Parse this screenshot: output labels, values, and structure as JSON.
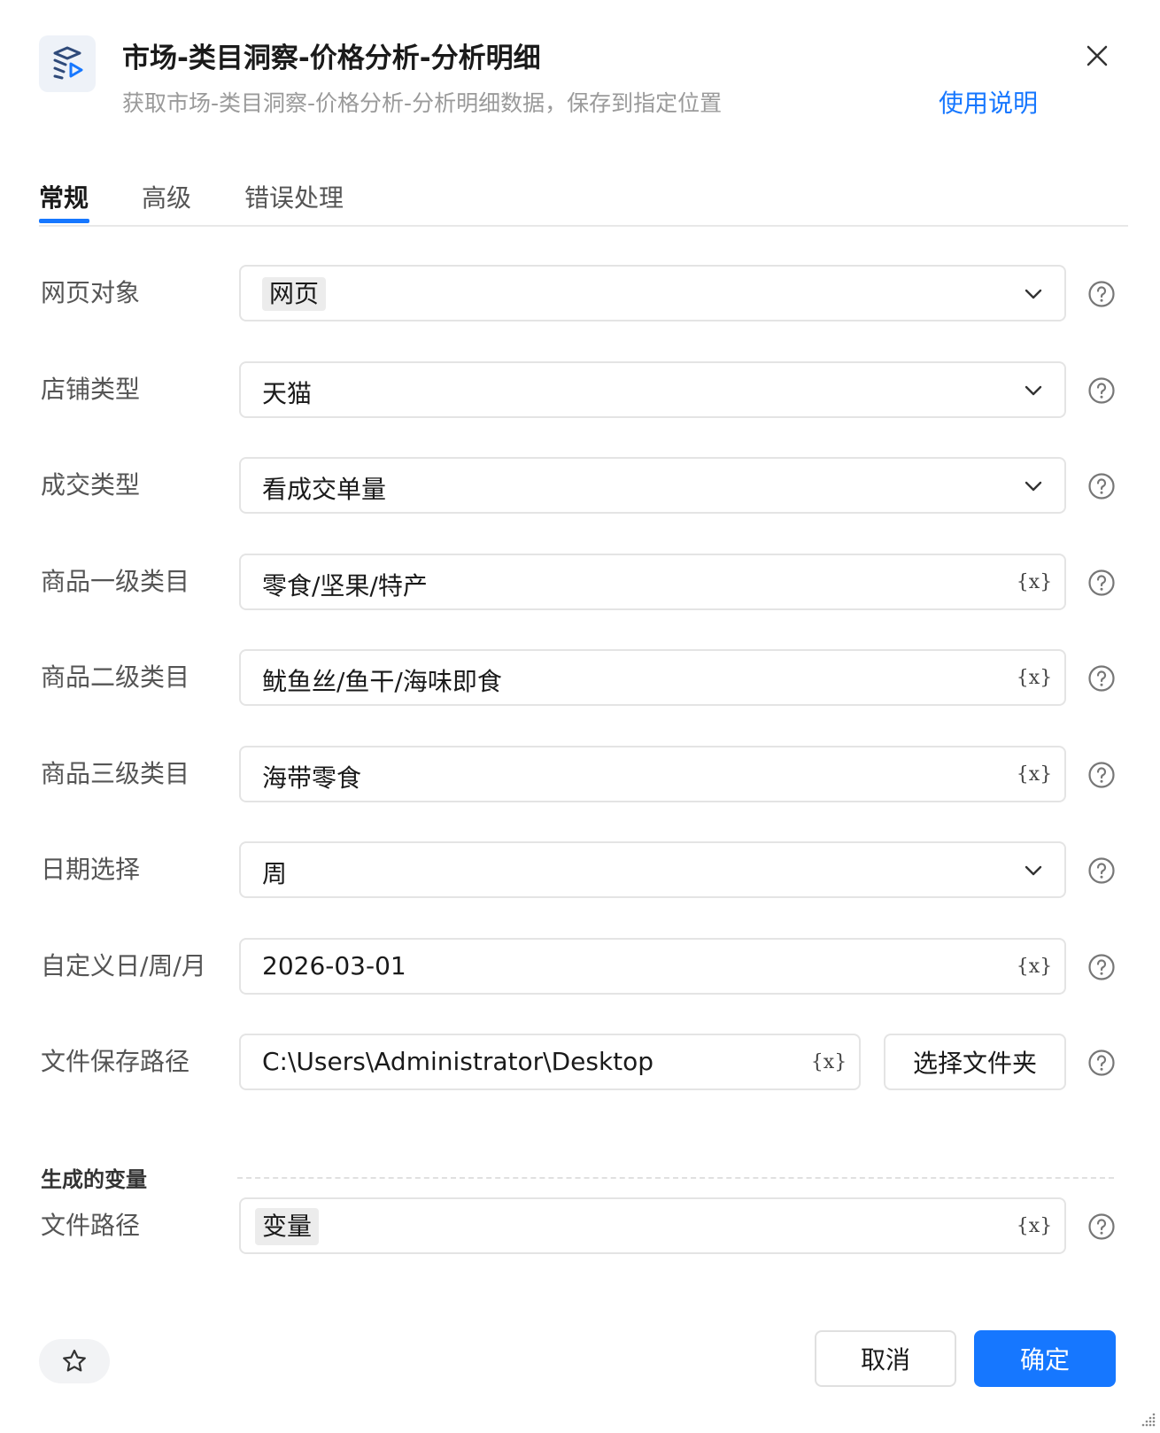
{
  "header": {
    "title": "市场-类目洞察-价格分析-分析明细",
    "subtitle": "获取市场-类目洞察-价格分析-分析明细数据，保存到指定位置",
    "help_link": "使用说明"
  },
  "tabs": [
    {
      "label": "常规",
      "active": true
    },
    {
      "label": "高级",
      "active": false
    },
    {
      "label": "错误处理",
      "active": false
    }
  ],
  "fields": {
    "webpage": {
      "label": "网页对象",
      "value": "网页"
    },
    "store_type": {
      "label": "店铺类型",
      "value": "天猫"
    },
    "deal_type": {
      "label": "成交类型",
      "value": "看成交单量"
    },
    "category_l1": {
      "label": "商品一级类目",
      "value": "零食/坚果/特产"
    },
    "category_l2": {
      "label": "商品二级类目",
      "value": "鱿鱼丝/鱼干/海味即食"
    },
    "category_l3": {
      "label": "商品三级类目",
      "value": "海带零食"
    },
    "date_select": {
      "label": "日期选择",
      "value": "周"
    },
    "custom_date": {
      "label": "自定义日/周/月",
      "value": "2026-03-01"
    },
    "save_path": {
      "label": "文件保存路径",
      "value": "C:\\Users\\Administrator\\Desktop",
      "button": "选择文件夹"
    }
  },
  "output_section": {
    "title": "生成的变量",
    "file_path": {
      "label": "文件路径",
      "value": "变量"
    }
  },
  "var_symbol": "{x}",
  "footer": {
    "cancel": "取消",
    "confirm": "确定"
  },
  "colors": {
    "accent": "#1677ff",
    "label": "#555555",
    "border": "#e4e4e4"
  }
}
